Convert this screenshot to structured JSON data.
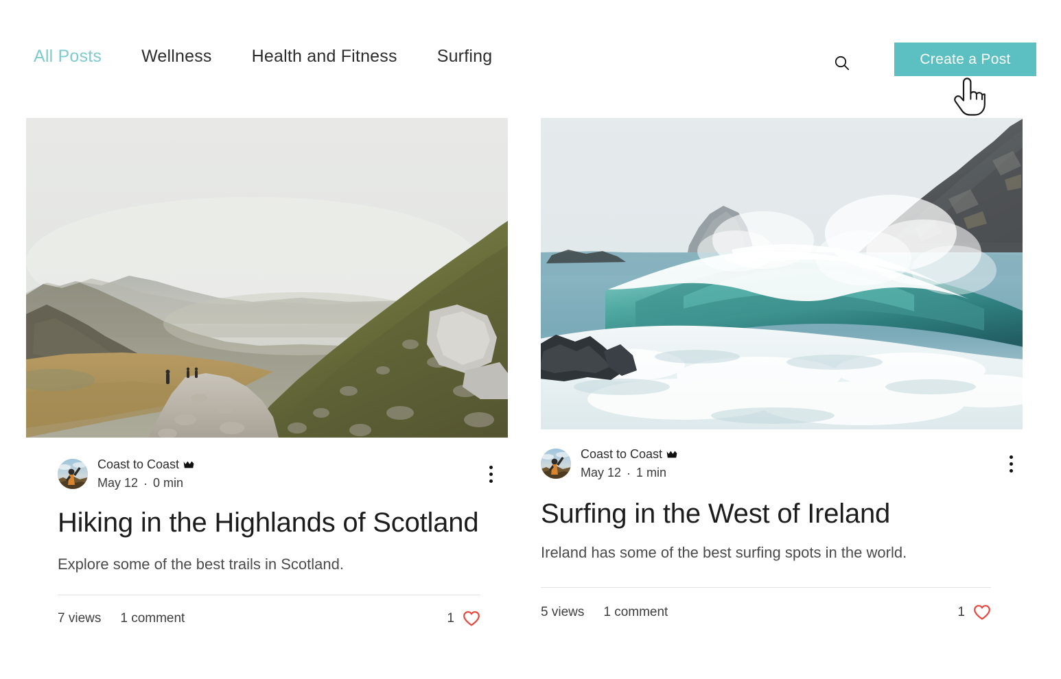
{
  "nav": {
    "tabs": [
      {
        "label": "All Posts",
        "active": true
      },
      {
        "label": "Wellness",
        "active": false
      },
      {
        "label": "Health and Fitness",
        "active": false
      },
      {
        "label": "Surfing",
        "active": false
      }
    ],
    "search_icon": "search-icon",
    "create_post_label": "Create a Post",
    "accent_color": "#5cbfc2",
    "active_tab_color": "#7ecbce"
  },
  "cursor": {
    "type": "pointing-hand-cursor"
  },
  "posts": [
    {
      "cover_alt": "misty-highland-trail-photo",
      "author": "Coast to Coast",
      "badge_icon": "crown-icon",
      "date": "May 12",
      "separator": "·",
      "read_time": "0 min",
      "title": "Hiking in the Highlands of Scotland",
      "excerpt": "Explore some of the best trails in Scotland.",
      "views": "7 views",
      "comments": "1 comment",
      "likes": "1",
      "like_icon": "heart-icon",
      "like_color": "#e8453c",
      "more_icon": "more-vertical-icon"
    },
    {
      "cover_alt": "crashing-ocean-wave-photo",
      "author": "Coast to Coast",
      "badge_icon": "crown-icon",
      "date": "May 12",
      "separator": "·",
      "read_time": "1 min",
      "title": "Surfing in the West of Ireland",
      "excerpt": "Ireland has some of the best surfing spots in the world.",
      "views": "5 views",
      "comments": "1 comment",
      "likes": "1",
      "like_icon": "heart-icon",
      "like_color": "#e8453c",
      "more_icon": "more-vertical-icon"
    }
  ]
}
